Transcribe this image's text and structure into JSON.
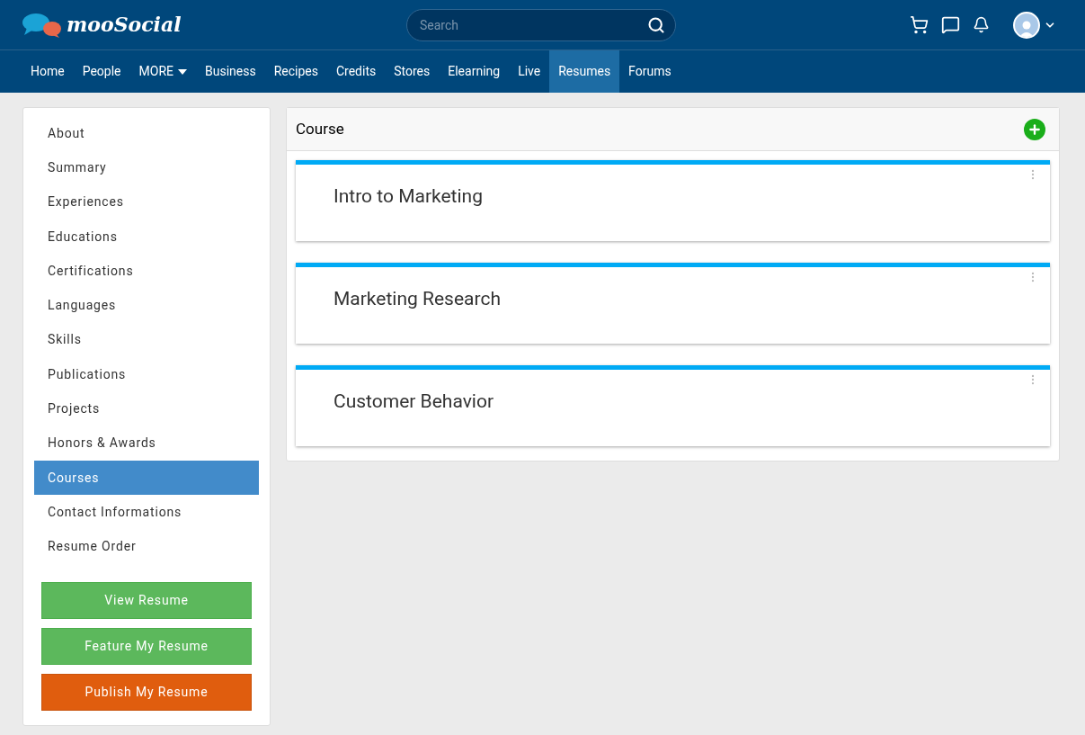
{
  "header": {
    "logo": "mooSocial",
    "search": {
      "placeholder": "Search"
    }
  },
  "nav": [
    {
      "label": "Home",
      "selected": false
    },
    {
      "label": "People",
      "selected": false
    },
    {
      "label": "MORE",
      "selected": false,
      "kind": "dropdown"
    },
    {
      "label": "Business",
      "selected": false
    },
    {
      "label": "Recipes",
      "selected": false
    },
    {
      "label": "Credits",
      "selected": false
    },
    {
      "label": "Stores",
      "selected": false
    },
    {
      "label": "Elearning",
      "selected": false
    },
    {
      "label": "Live",
      "selected": false
    },
    {
      "label": "Resumes",
      "selected": true
    },
    {
      "label": "Forums",
      "selected": false
    }
  ],
  "sidebar": {
    "items": [
      {
        "label": "About",
        "selected": false
      },
      {
        "label": "Summary",
        "selected": false
      },
      {
        "label": "Experiences",
        "selected": false
      },
      {
        "label": "Educations",
        "selected": false
      },
      {
        "label": "Certifications",
        "selected": false
      },
      {
        "label": "Languages",
        "selected": false
      },
      {
        "label": "Skills",
        "selected": false
      },
      {
        "label": "Publications",
        "selected": false
      },
      {
        "label": "Projects",
        "selected": false
      },
      {
        "label": "Honors & Awards",
        "selected": false
      },
      {
        "label": "Courses",
        "selected": true
      },
      {
        "label": "Contact Informations",
        "selected": false
      },
      {
        "label": "Resume Order",
        "selected": false
      }
    ],
    "buttons": [
      {
        "label": "View Resume",
        "kind": "success"
      },
      {
        "label": "Feature My Resume",
        "kind": "success"
      },
      {
        "label": "Publish My Resume",
        "kind": "warning"
      }
    ]
  },
  "panel": {
    "title": "Course",
    "courses": [
      {
        "title": "Intro to Marketing"
      },
      {
        "title": "Marketing Research"
      },
      {
        "title": "Customer Behavior"
      }
    ]
  }
}
